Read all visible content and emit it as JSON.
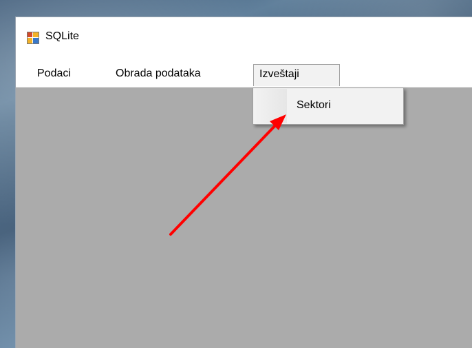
{
  "window": {
    "title": "SQLite",
    "icon": "app-window-icon"
  },
  "menu": {
    "items": [
      {
        "label": "Podaci"
      },
      {
        "label": "Obrada podataka"
      },
      {
        "label": "Izveštaji"
      }
    ],
    "open_index": 2
  },
  "dropdown": {
    "items": [
      {
        "label": "Sektori"
      }
    ]
  },
  "annotation": {
    "type": "arrow",
    "color": "#ff0000",
    "points_to": "dropdown-item-sektori"
  },
  "colors": {
    "client_area": "#ababab",
    "menu_background": "#ffffff",
    "dropdown_background": "#f2f2f2"
  }
}
